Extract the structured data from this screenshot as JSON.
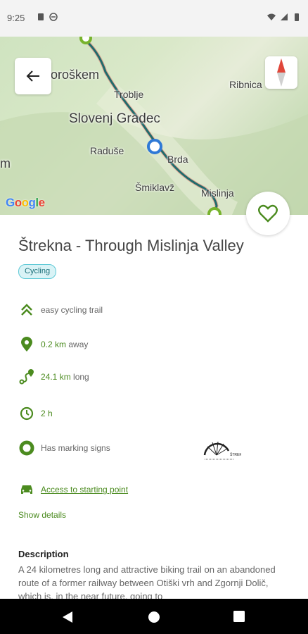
{
  "status_bar": {
    "time": "9:25"
  },
  "map": {
    "labels": [
      "oroškem",
      "Troblje",
      "Ribnica",
      "Slovenj Gradec",
      "Raduše",
      "Brda",
      "Šmiklavž",
      "Mislinja",
      "m"
    ],
    "google": "Google",
    "colors": {
      "route": "#1f6c6c",
      "route_glow": "#e2605a",
      "marker": "#2f79d6",
      "endpoint": "#78b32d"
    }
  },
  "trail": {
    "title": "Štrekna - Through Mislinja Valley",
    "category": "Cycling",
    "difficulty": "easy cycling trail",
    "distance_away_value": "0.2 km",
    "distance_away_suffix": " away",
    "length_value": "24.1 km",
    "length_suffix": " long",
    "duration": "2 h",
    "marking": "Has marking signs",
    "access_link": "Access to starting point",
    "show_details": "Show details",
    "logo_text": "ŠTREKNA"
  },
  "description": {
    "heading": "Description",
    "text": "A 24 kilometres long and attractive biking trail on an abandoned route of a former railway between Otiški vrh and Zgornji Dolič, which is, in the near future, going to"
  },
  "icons": {
    "back": "arrow-left-icon",
    "compass": "compass-icon",
    "favorite": "heart-outline-icon",
    "difficulty": "double-chevron-up-icon",
    "location": "location-pin-icon",
    "route": "route-icon",
    "clock": "clock-icon",
    "marking": "ring-icon",
    "car": "car-icon"
  },
  "accent": "#4b8b1f"
}
